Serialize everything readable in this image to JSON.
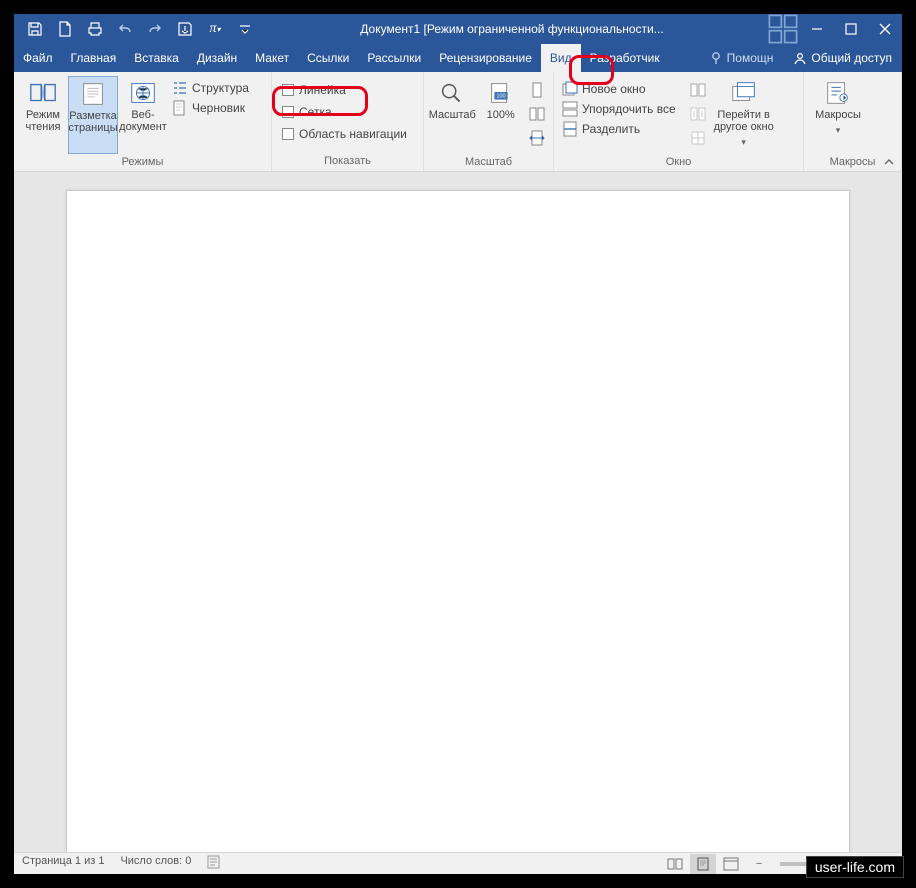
{
  "title": "Документ1 [Режим ограниченной функциональности...",
  "tabs": {
    "file": "Файл",
    "home": "Главная",
    "insert": "Вставка",
    "design": "Дизайн",
    "layout": "Макет",
    "references": "Ссылки",
    "mailings": "Рассылки",
    "review": "Рецензирование",
    "view": "Вид",
    "developer": "Разработчик"
  },
  "help": "Помощн",
  "share": "Общий доступ",
  "ribbon": {
    "modes": {
      "read": "Режим чтения",
      "print": "Разметка страницы",
      "web": "Веб-документ",
      "outline": "Структура",
      "draft": "Черновик",
      "label": "Режимы"
    },
    "show": {
      "ruler": "Линейка",
      "grid": "Сетка",
      "nav": "Область навигации",
      "label": "Показать"
    },
    "zoom": {
      "zoom": "Масштаб",
      "hundred": "100%",
      "label": "Масштаб"
    },
    "window": {
      "neww": "Новое окно",
      "arrange": "Упорядочить все",
      "split": "Разделить",
      "switch": "Перейти в другое окно",
      "label": "Окно"
    },
    "macros": {
      "macros": "Макросы",
      "label": "Макросы"
    }
  },
  "status": {
    "page": "Страница 1 из 1",
    "words": "Число слов: 0"
  },
  "watermark": "user-life.com"
}
